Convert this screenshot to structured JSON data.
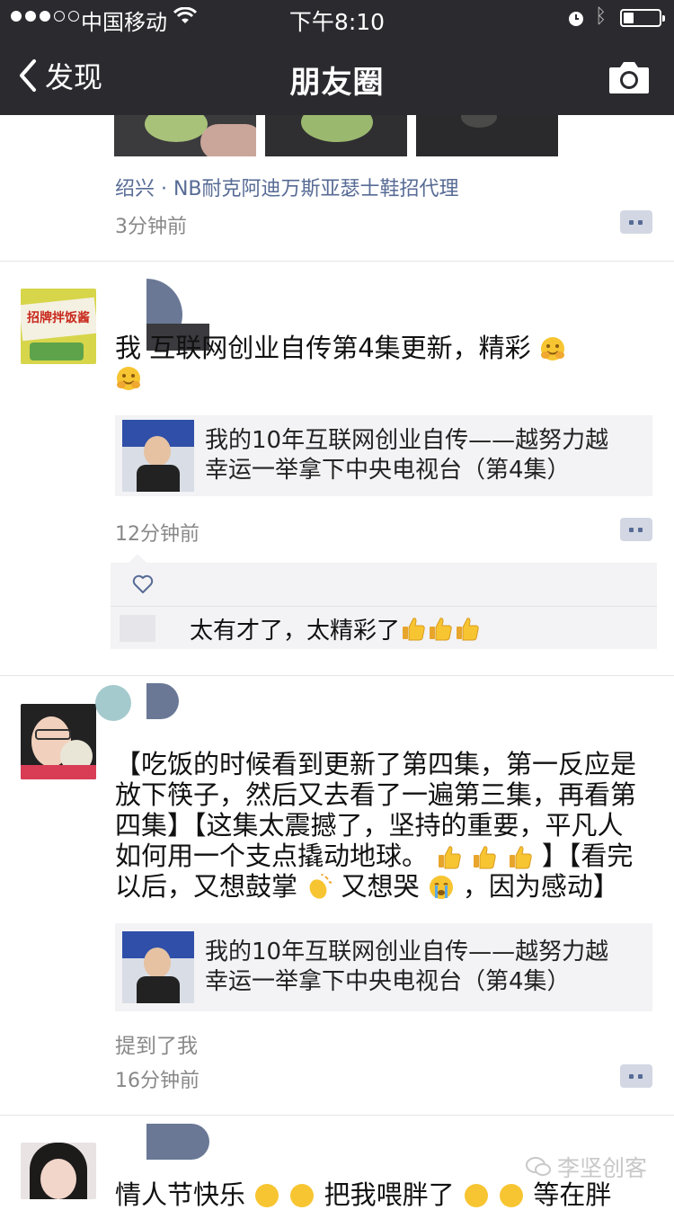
{
  "status_bar": {
    "carrier": "中国移动",
    "time": "下午8:10",
    "battery_level": 0.3
  },
  "nav": {
    "back_label": "发现",
    "title": "朋友圈"
  },
  "post0": {
    "location": "绍兴 · NB耐克阿迪万斯亚瑟士鞋招代理",
    "time_ago": "3分钟前"
  },
  "post1": {
    "text_line1": "我  互联网创业自传第4集更新，精彩",
    "link_title_l1": "我的10年互联网创业自传——越努力越",
    "link_title_l2": "幸运一举拿下中央电视台（第4集）",
    "time_ago": "12分钟前",
    "comment_text": "太有才了，太精彩了",
    "avatar_text": "招牌拌饭酱"
  },
  "post2": {
    "text_l1": "【吃饭的时候看到更新了第四集，第一反应是",
    "text_l2": "放下筷子，然后又去看了一遍第三集，再看第",
    "text_l3": "四集】【这集太震撼了，坚持的重要，平凡人",
    "text_l4": "如何用一个支点撬动地球。",
    "text_l4b": "】【看完",
    "text_l5": "以后，又想鼓掌",
    "text_l5b": "又想哭",
    "text_l5c": "，因为感动】",
    "link_title_l1": "我的10年互联网创业自传——越努力越",
    "link_title_l2": "幸运一举拿下中央电视台（第4集）",
    "mention": "提到了我",
    "time_ago": "16分钟前"
  },
  "post3": {
    "text_start": "情人节快乐",
    "text_mid": "把我喂胖了",
    "text_end": "等在胖"
  },
  "watermark": "李坚创客",
  "colors": {
    "nav_bg": "#2b2a2f",
    "link_blue": "#576b95",
    "card_bg": "#f3f3f5"
  }
}
